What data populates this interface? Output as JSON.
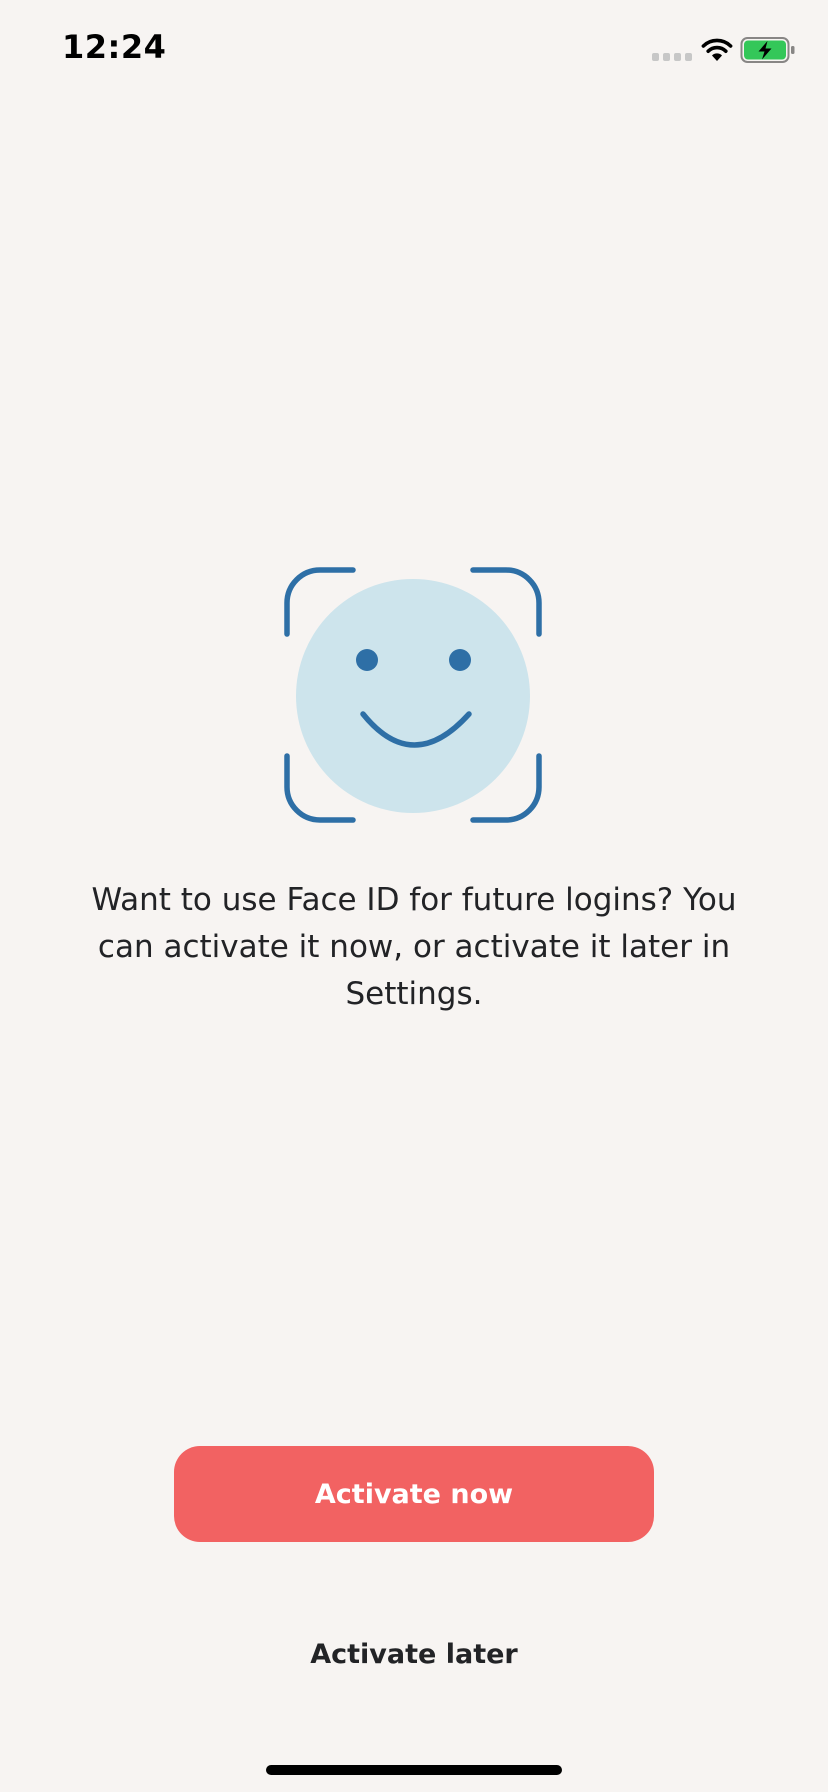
{
  "status_bar": {
    "time": "12:24",
    "signal_icon": "signal-dots-icon",
    "wifi_icon": "wifi-icon",
    "battery_icon": "battery-charging-icon",
    "battery_color": "#34c759"
  },
  "illustration": {
    "icon": "face-id-icon",
    "face_color": "#cde4ec",
    "line_color": "#2e6fa6"
  },
  "prompt": {
    "text": "Want to use Face ID for future logins? You can activate it now, or activate it later in Settings."
  },
  "actions": {
    "activate_now_label": "Activate now",
    "activate_later_label": "Activate later",
    "primary_color": "#f26262"
  }
}
